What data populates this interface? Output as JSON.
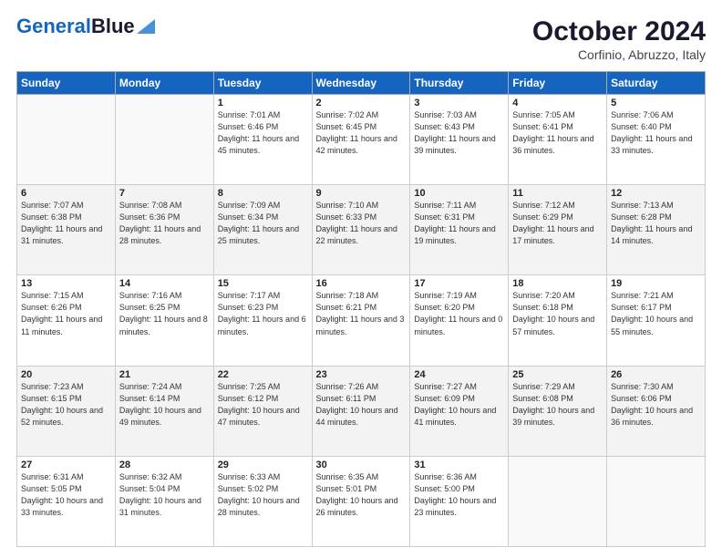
{
  "header": {
    "logo_line1": "General",
    "logo_line2": "Blue",
    "title": "October 2024",
    "subtitle": "Corfinio, Abruzzo, Italy"
  },
  "days_of_week": [
    "Sunday",
    "Monday",
    "Tuesday",
    "Wednesday",
    "Thursday",
    "Friday",
    "Saturday"
  ],
  "weeks": [
    [
      {
        "day": "",
        "info": ""
      },
      {
        "day": "",
        "info": ""
      },
      {
        "day": "1",
        "info": "Sunrise: 7:01 AM\nSunset: 6:46 PM\nDaylight: 11 hours and 45 minutes."
      },
      {
        "day": "2",
        "info": "Sunrise: 7:02 AM\nSunset: 6:45 PM\nDaylight: 11 hours and 42 minutes."
      },
      {
        "day": "3",
        "info": "Sunrise: 7:03 AM\nSunset: 6:43 PM\nDaylight: 11 hours and 39 minutes."
      },
      {
        "day": "4",
        "info": "Sunrise: 7:05 AM\nSunset: 6:41 PM\nDaylight: 11 hours and 36 minutes."
      },
      {
        "day": "5",
        "info": "Sunrise: 7:06 AM\nSunset: 6:40 PM\nDaylight: 11 hours and 33 minutes."
      }
    ],
    [
      {
        "day": "6",
        "info": "Sunrise: 7:07 AM\nSunset: 6:38 PM\nDaylight: 11 hours and 31 minutes."
      },
      {
        "day": "7",
        "info": "Sunrise: 7:08 AM\nSunset: 6:36 PM\nDaylight: 11 hours and 28 minutes."
      },
      {
        "day": "8",
        "info": "Sunrise: 7:09 AM\nSunset: 6:34 PM\nDaylight: 11 hours and 25 minutes."
      },
      {
        "day": "9",
        "info": "Sunrise: 7:10 AM\nSunset: 6:33 PM\nDaylight: 11 hours and 22 minutes."
      },
      {
        "day": "10",
        "info": "Sunrise: 7:11 AM\nSunset: 6:31 PM\nDaylight: 11 hours and 19 minutes."
      },
      {
        "day": "11",
        "info": "Sunrise: 7:12 AM\nSunset: 6:29 PM\nDaylight: 11 hours and 17 minutes."
      },
      {
        "day": "12",
        "info": "Sunrise: 7:13 AM\nSunset: 6:28 PM\nDaylight: 11 hours and 14 minutes."
      }
    ],
    [
      {
        "day": "13",
        "info": "Sunrise: 7:15 AM\nSunset: 6:26 PM\nDaylight: 11 hours and 11 minutes."
      },
      {
        "day": "14",
        "info": "Sunrise: 7:16 AM\nSunset: 6:25 PM\nDaylight: 11 hours and 8 minutes."
      },
      {
        "day": "15",
        "info": "Sunrise: 7:17 AM\nSunset: 6:23 PM\nDaylight: 11 hours and 6 minutes."
      },
      {
        "day": "16",
        "info": "Sunrise: 7:18 AM\nSunset: 6:21 PM\nDaylight: 11 hours and 3 minutes."
      },
      {
        "day": "17",
        "info": "Sunrise: 7:19 AM\nSunset: 6:20 PM\nDaylight: 11 hours and 0 minutes."
      },
      {
        "day": "18",
        "info": "Sunrise: 7:20 AM\nSunset: 6:18 PM\nDaylight: 10 hours and 57 minutes."
      },
      {
        "day": "19",
        "info": "Sunrise: 7:21 AM\nSunset: 6:17 PM\nDaylight: 10 hours and 55 minutes."
      }
    ],
    [
      {
        "day": "20",
        "info": "Sunrise: 7:23 AM\nSunset: 6:15 PM\nDaylight: 10 hours and 52 minutes."
      },
      {
        "day": "21",
        "info": "Sunrise: 7:24 AM\nSunset: 6:14 PM\nDaylight: 10 hours and 49 minutes."
      },
      {
        "day": "22",
        "info": "Sunrise: 7:25 AM\nSunset: 6:12 PM\nDaylight: 10 hours and 47 minutes."
      },
      {
        "day": "23",
        "info": "Sunrise: 7:26 AM\nSunset: 6:11 PM\nDaylight: 10 hours and 44 minutes."
      },
      {
        "day": "24",
        "info": "Sunrise: 7:27 AM\nSunset: 6:09 PM\nDaylight: 10 hours and 41 minutes."
      },
      {
        "day": "25",
        "info": "Sunrise: 7:29 AM\nSunset: 6:08 PM\nDaylight: 10 hours and 39 minutes."
      },
      {
        "day": "26",
        "info": "Sunrise: 7:30 AM\nSunset: 6:06 PM\nDaylight: 10 hours and 36 minutes."
      }
    ],
    [
      {
        "day": "27",
        "info": "Sunrise: 6:31 AM\nSunset: 5:05 PM\nDaylight: 10 hours and 33 minutes."
      },
      {
        "day": "28",
        "info": "Sunrise: 6:32 AM\nSunset: 5:04 PM\nDaylight: 10 hours and 31 minutes."
      },
      {
        "day": "29",
        "info": "Sunrise: 6:33 AM\nSunset: 5:02 PM\nDaylight: 10 hours and 28 minutes."
      },
      {
        "day": "30",
        "info": "Sunrise: 6:35 AM\nSunset: 5:01 PM\nDaylight: 10 hours and 26 minutes."
      },
      {
        "day": "31",
        "info": "Sunrise: 6:36 AM\nSunset: 5:00 PM\nDaylight: 10 hours and 23 minutes."
      },
      {
        "day": "",
        "info": ""
      },
      {
        "day": "",
        "info": ""
      }
    ]
  ]
}
